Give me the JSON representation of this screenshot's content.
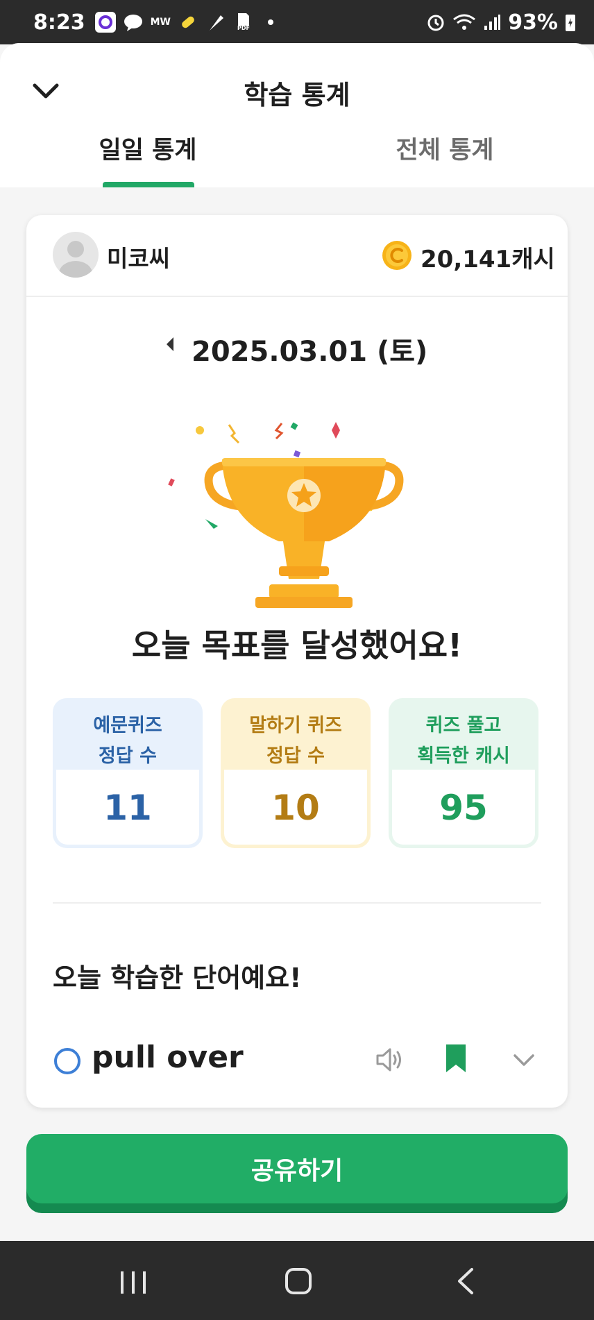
{
  "status_bar": {
    "time": "8:23",
    "app_label": "MW",
    "file_badge": "PDF",
    "battery": "93%"
  },
  "header": {
    "title": "학습 통계",
    "back_icon": "chevron-down-icon",
    "tabs": [
      {
        "label": "일일 통계",
        "active": true
      },
      {
        "label": "전체 통계",
        "active": false
      }
    ]
  },
  "user": {
    "name": "미코씨",
    "cash": "20,141캐시",
    "coin_icon": "coin-icon"
  },
  "date": {
    "text": "2025.03.01 (토)",
    "prev_icon": "triangle-left-icon"
  },
  "achievement": {
    "icon": "trophy-icon",
    "message": "오늘 목표를 달성했어요!"
  },
  "stats": [
    {
      "label": "예문퀴즈\n정답 수",
      "value": "11",
      "color": "#2b62a6"
    },
    {
      "label": "말하기 퀴즈\n정답 수",
      "value": "10",
      "color": "#b37c14"
    },
    {
      "label": "퀴즈 풀고\n획득한 캐시",
      "value": "95",
      "color": "#1f9e5c"
    }
  ],
  "words": {
    "title": "오늘 학습한 단어예요!",
    "items": [
      {
        "word": "pull over",
        "bookmarked": true
      }
    ]
  },
  "share_button": {
    "label": "공유하기"
  },
  "colors": {
    "accent": "#21ad66",
    "tab_indicator": "#21a866"
  },
  "nav_bar": {
    "icons": [
      "recents-icon",
      "home-icon",
      "back-icon"
    ]
  }
}
